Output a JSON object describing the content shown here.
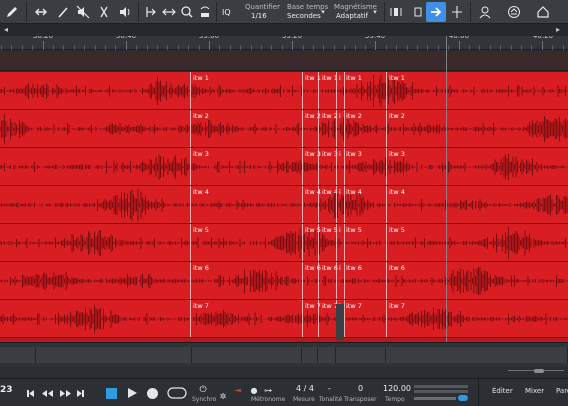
{
  "toolbar": {
    "quantize_label": "Quantifier",
    "quantize_value": "1/16",
    "timebase_label": "Base temps",
    "timebase_value": "Secondes",
    "snap_label": "Magnétisme",
    "snap_value": "Adaptatif",
    "iq_label": "IQ"
  },
  "ruler": {
    "labels": [
      "38:20",
      "38:40",
      "39:00",
      "39:20",
      "39:40",
      "40:00",
      "40:20"
    ]
  },
  "tracks": [
    {
      "clip_labels": [
        "itw 1",
        "itw 1",
        "itw 1",
        "i",
        "itw 1",
        "itw 1"
      ]
    },
    {
      "clip_labels": [
        "itw 2",
        "itw 2",
        "itw 2",
        "i",
        "itw 2",
        "itw 2"
      ]
    },
    {
      "clip_labels": [
        "itw 3",
        "itw 3",
        "itw 3",
        "i",
        "itw 3",
        "itw 3"
      ]
    },
    {
      "clip_labels": [
        "itw 4",
        "itw 4",
        "itw 4",
        "i",
        "itw 4",
        "itw 4"
      ]
    },
    {
      "clip_labels": [
        "itw 5",
        "itw 5",
        "itw 5",
        "i",
        "itw 5",
        "itw 5"
      ]
    },
    {
      "clip_labels": [
        "itw 6",
        "itw 6",
        "itw 6",
        "i",
        "itw 6",
        "itw 6"
      ]
    },
    {
      "clip_labels": [
        "itw 7",
        "itw 7",
        "itw 7",
        "i",
        "itw 7",
        "itw 7"
      ]
    }
  ],
  "transport": {
    "time_fragment": "23",
    "sync_label": "Synchro",
    "metronome_label": "Métronome",
    "time_signature": "4 / 4",
    "measure_label": "Mesure",
    "key_value": "-",
    "key_label": "Tonalité",
    "transpose_value": "0",
    "transpose_label": "Transposer",
    "tempo_value": "120.00",
    "tempo_label": "Tempo",
    "tab_edit": "Éditer",
    "tab_mixer": "Mixer",
    "tab_partial": "Parc"
  },
  "colors": {
    "track_red": "#d81e22",
    "accent_blue": "#3f8fe6",
    "loop_blue": "#2f9be0"
  }
}
